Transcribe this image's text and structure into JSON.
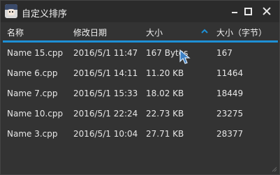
{
  "window": {
    "title": "自定义排序"
  },
  "columns": [
    {
      "label": "名称"
    },
    {
      "label": "修改日期"
    },
    {
      "label": "大小"
    },
    {
      "label": "大小（字节）"
    }
  ],
  "sort": {
    "column_index": 3,
    "direction": "ascending",
    "icon": "chevron-up-icon"
  },
  "rows": [
    {
      "name": "Name 15.cpp",
      "modified": "2016/5/1 11:47",
      "size": "167 Bytes",
      "bytes": "167"
    },
    {
      "name": "Name 6.cpp",
      "modified": "2016/5/1 14:11",
      "size": "11.20 KB",
      "bytes": "11464"
    },
    {
      "name": "Name 7.cpp",
      "modified": "2016/5/1 15:33",
      "size": "18.02 KB",
      "bytes": "18449"
    },
    {
      "name": "Name 10.cpp",
      "modified": "2016/5/1 22:24",
      "size": "22.73 KB",
      "bytes": "23275"
    },
    {
      "name": "Name 3.cpp",
      "modified": "2016/5/1 10:04",
      "size": "27.71 KB",
      "bytes": "28377"
    }
  ],
  "colors": {
    "background": "#333333",
    "titlebar": "#2b2b2b",
    "accent": "#1e90d6",
    "text": "#e6e6e6"
  }
}
